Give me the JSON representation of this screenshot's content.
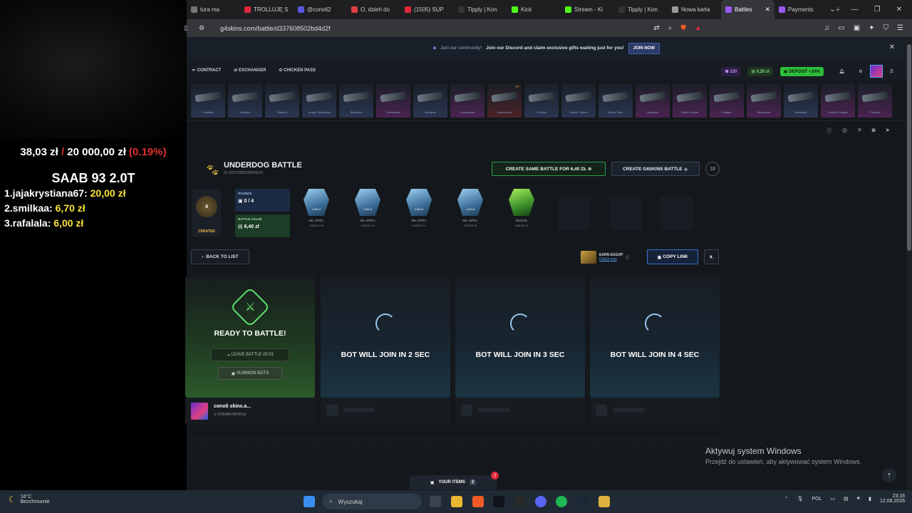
{
  "overlay": {
    "balance": "38,03 zł",
    "separator": "/",
    "goal": "20 000,00 zł",
    "percent": "(0.19%)",
    "title": "SAAB 93 2.0T",
    "ranking": [
      {
        "name": "1.jajakrystiana67:",
        "amount": "20,00 zł"
      },
      {
        "name": "2.smilkaa:",
        "amount": "6,70 zł"
      },
      {
        "name": "3.rafalala:",
        "amount": "6,00 zł"
      }
    ]
  },
  "browser": {
    "tabs": [
      {
        "label": "tura ma",
        "color": "#777"
      },
      {
        "label": "TROLLUJĘ S",
        "color": "#e0283a"
      },
      {
        "label": "@conoli2",
        "color": "#5a5ae0"
      },
      {
        "label": "O, dzień do",
        "color": "#e04040"
      },
      {
        "label": "(1505) SUP",
        "color": "#e0283a"
      },
      {
        "label": "Tipply | Kon",
        "color": "#333"
      },
      {
        "label": "Kick",
        "color": "#53fc18"
      },
      {
        "label": "Stream - Ki",
        "color": "#53fc18"
      },
      {
        "label": "Tipply | Kon",
        "color": "#333"
      },
      {
        "label": "Nowa karta",
        "color": "#999"
      },
      {
        "label": "Battles",
        "color": "#9a5af0",
        "active": true
      },
      {
        "label": "Payments",
        "color": "#9a5af0"
      }
    ],
    "url": "g4skins.com/battle/d337608502bd4d2f"
  },
  "banner": {
    "pre": "Join our community!",
    "main": "Join our Discord and claim exclusive gifts waiting just for you!",
    "button": "JOIN NOW"
  },
  "nav": {
    "items": [
      "CONTRACT",
      "EXCHANGER",
      "CHICKEN PASS"
    ],
    "points": "220",
    "balance": "0,20 zł",
    "deposit": "DEPOSIT +10%"
  },
  "drops": [
    {
      "name": "Capillary",
      "color": "#2a3550"
    },
    {
      "name": "Sickland",
      "color": "#2a3550"
    },
    {
      "name": "Warbird",
      "color": "#2a3550"
    },
    {
      "name": "Jungle Slipstream",
      "color": "#2a3550"
    },
    {
      "name": "Bluesteel",
      "color": "#2a3550"
    },
    {
      "name": "Freestream",
      "color": "#4a2350"
    },
    {
      "name": "Hydraulic",
      "color": "#2a3550"
    },
    {
      "name": "Crossroads",
      "color": "#4a2350"
    },
    {
      "name": "Interlocked",
      "color": "#4a2228",
      "tag": "ST"
    },
    {
      "name": "Phobos",
      "color": "#2a3550"
    },
    {
      "name": "Poplar Thicket",
      "color": "#2a3550"
    },
    {
      "name": "Blood Tiger",
      "color": "#2a3550"
    },
    {
      "name": "Nemesis",
      "color": "#4a2350"
    },
    {
      "name": "Yellow Jacket",
      "color": "#4a2350"
    },
    {
      "name": "Oxygen",
      "color": "#4a2350"
    },
    {
      "name": "Bronzeoid",
      "color": "#4a2350"
    },
    {
      "name": "Warhawk",
      "color": "#2a3550"
    },
    {
      "name": "Sunrise Dragon",
      "color": "#4a2350"
    },
    {
      "name": "Phobos",
      "color": "#4a2350"
    }
  ],
  "battle": {
    "title": "UNDERDOG BATTLE",
    "id": "ID: D337608502BD4D2F",
    "same_button": "CREATE SAME BATTLE FOR 6,40 ZŁ",
    "g4_button": "CREATE G4SKINS BATTLE",
    "age": "18",
    "status": "CREATED",
    "team_label": "4",
    "rounds_label": "ROUNDS",
    "rounds_value": "0 / 4",
    "value_label": "BATTLE VALUE",
    "value": "6,40 zł",
    "cases": [
      {
        "price": "1,60 zł",
        "name": "MIL-SPEC",
        "check": "CHECK %"
      },
      {
        "price": "1,60 zł",
        "name": "MIL-SPEC",
        "check": "CHECK %"
      },
      {
        "price": "1,60 zł",
        "name": "MIL-SPEC",
        "check": "CHECK %"
      },
      {
        "price": "1,60 zł",
        "name": "MIL-SPEC",
        "check": "CHECK %"
      },
      {
        "price": "",
        "name": "BONUS",
        "check": "CHECK %"
      }
    ]
  },
  "controls": {
    "back": "BACK TO LIST",
    "earn_title": "EARN EGGXP",
    "earn_link": "Check now",
    "copy": "COPY LINK"
  },
  "slots": {
    "ready": "READY TO BATTLE!",
    "leave": "LEAVE BATTLE 00:01",
    "summon": "SUMMON BOTS",
    "bots": [
      "BOT WILL JOIN IN 2 SEC",
      "BOT WILL JOIN IN 3 SEC",
      "BOT WILL JOIN IN 4 SEC"
    ],
    "user_name": "conoli skins.a...",
    "user_profile": "STEAM PROFILE"
  },
  "windows": {
    "activate_title": "Aktywuj system Windows",
    "activate_sub": "Przejdź do ustawień, aby aktywować system Windows."
  },
  "bottom": {
    "your_items": "YOUR ITEMS",
    "items_count": "2",
    "badge": "2"
  },
  "taskbar": {
    "temp": "16°C",
    "weather": "Bezchmurnie",
    "search": "Wyszukaj",
    "lang": "POL",
    "time": "23:16",
    "date": "12.08.2026"
  }
}
